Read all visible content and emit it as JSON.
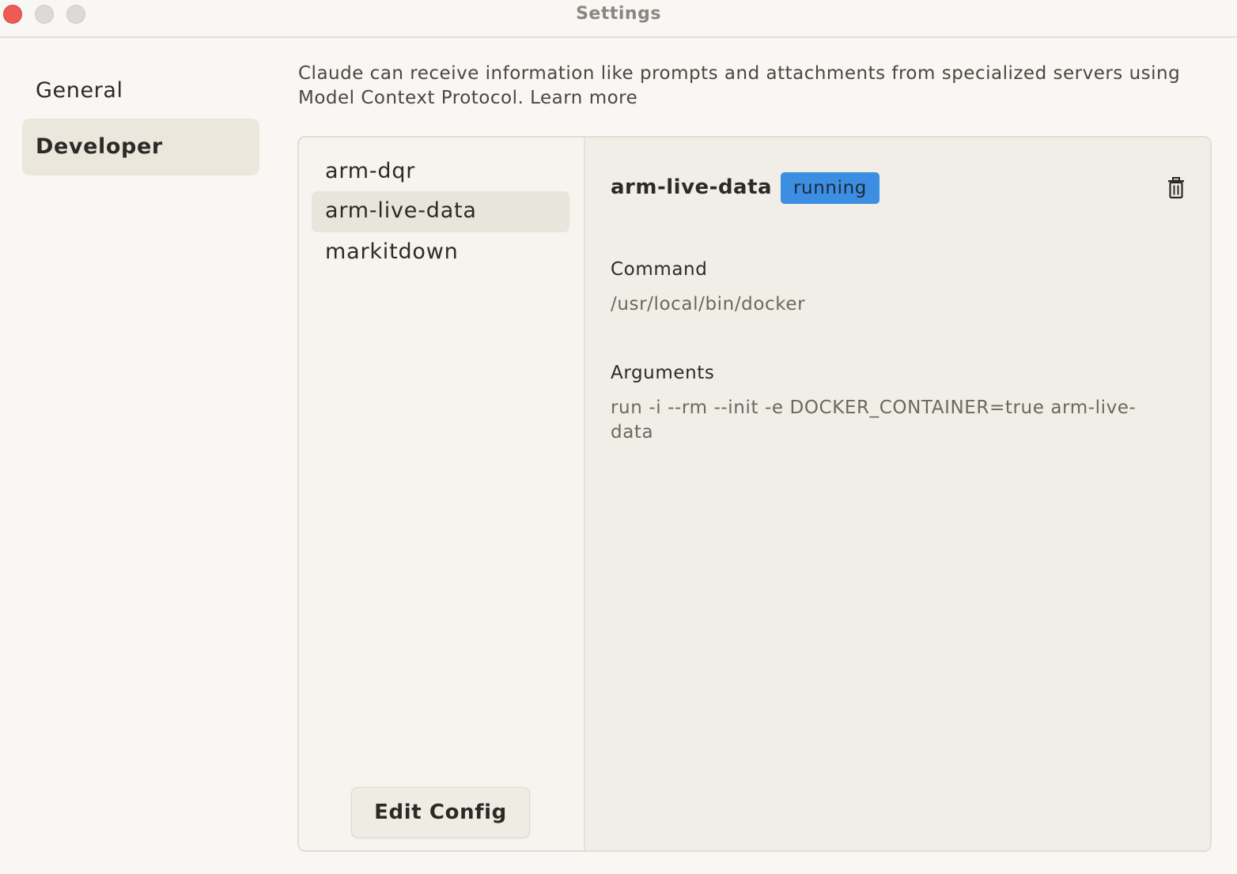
{
  "window": {
    "title": "Settings"
  },
  "nav": {
    "items": [
      {
        "label": "General",
        "selected": false
      },
      {
        "label": "Developer",
        "selected": true
      }
    ]
  },
  "developer": {
    "description": "Claude can receive information like prompts and attachments from specialized servers using Model Context Protocol.",
    "learn_more": "Learn more",
    "servers": [
      {
        "name": "arm-dqr",
        "selected": false
      },
      {
        "name": "arm-live-data",
        "selected": true
      },
      {
        "name": "markitdown",
        "selected": false
      }
    ],
    "edit_config_label": "Edit Config",
    "detail": {
      "name": "arm-live-data",
      "status": "running",
      "status_color": "#3b8ee2",
      "delete_icon": "trash-icon",
      "command_label": "Command",
      "command_value": "/usr/local/bin/docker",
      "arguments_label": "Arguments",
      "arguments_value": "run -i --rm --init -e DOCKER_CONTAINER=true arm-live-data"
    }
  }
}
